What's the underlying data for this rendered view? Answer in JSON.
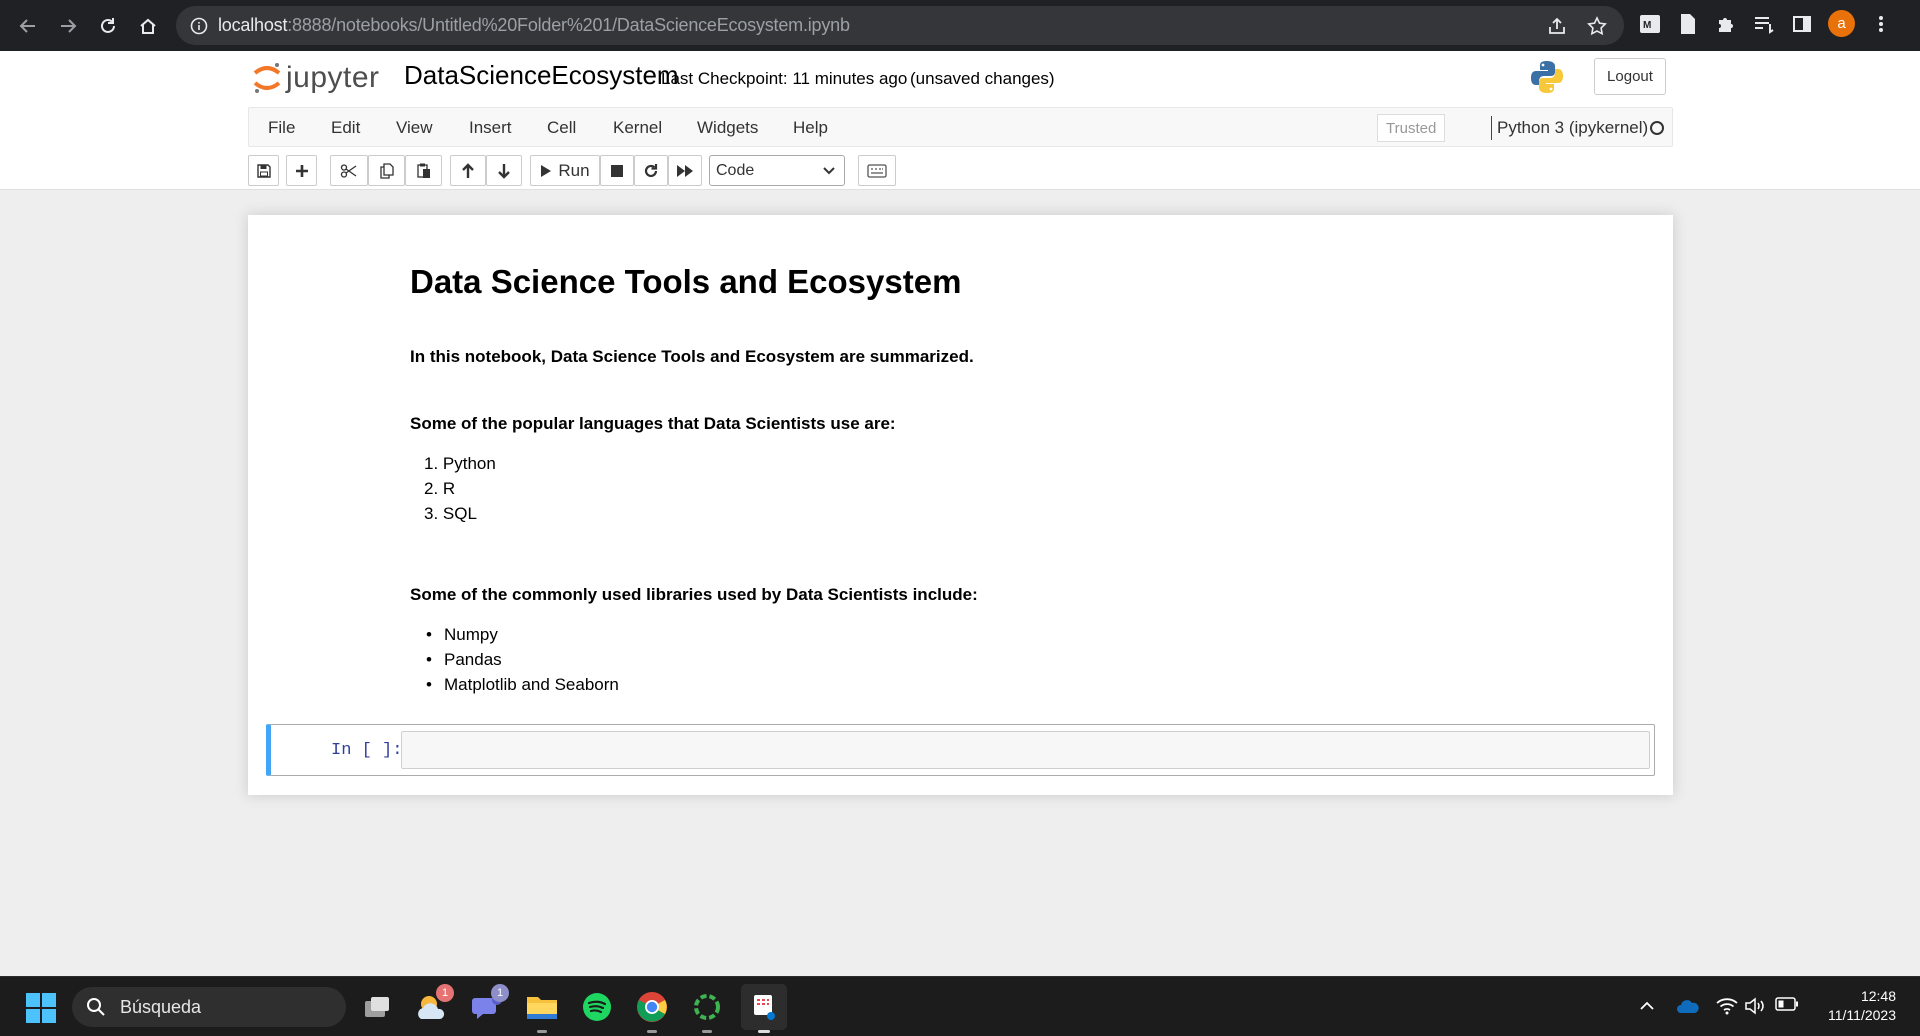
{
  "browser": {
    "url_host": "localhost",
    "url_rest": ":8888/notebooks/Untitled%20Folder%201/DataScienceEcosystem.ipynb",
    "profile_initial": "a"
  },
  "header": {
    "logo_text": "jupyter",
    "notebook_name": "DataScienceEcosystem",
    "checkpoint": "Last Checkpoint: 11 minutes ago",
    "unsaved": "(unsaved changes)",
    "logout": "Logout"
  },
  "menu": {
    "items": [
      "File",
      "Edit",
      "View",
      "Insert",
      "Cell",
      "Kernel",
      "Widgets",
      "Help"
    ],
    "trusted": "Trusted",
    "kernel": "Python 3 (ipykernel)"
  },
  "toolbar": {
    "run": "Run",
    "cell_type": "Code"
  },
  "notebook": {
    "title": "Data Science Tools and Ecosystem",
    "intro": "In this notebook, Data Science Tools and Ecosystem are summarized.",
    "languages_heading": "Some of the popular languages that Data Scientists use are:",
    "languages": [
      "1. Python",
      "2. R",
      "3. SQL"
    ],
    "libraries_heading": "Some of the commonly used libraries used by Data Scientists include:",
    "libraries": [
      "Numpy",
      "Pandas",
      "Matplotlib and Seaborn"
    ],
    "prompt": "In [ ]:"
  },
  "taskbar": {
    "search": "Búsqueda",
    "badge_weather": "1",
    "badge_teams": "1",
    "time": "12:48",
    "date": "11/11/2023"
  }
}
